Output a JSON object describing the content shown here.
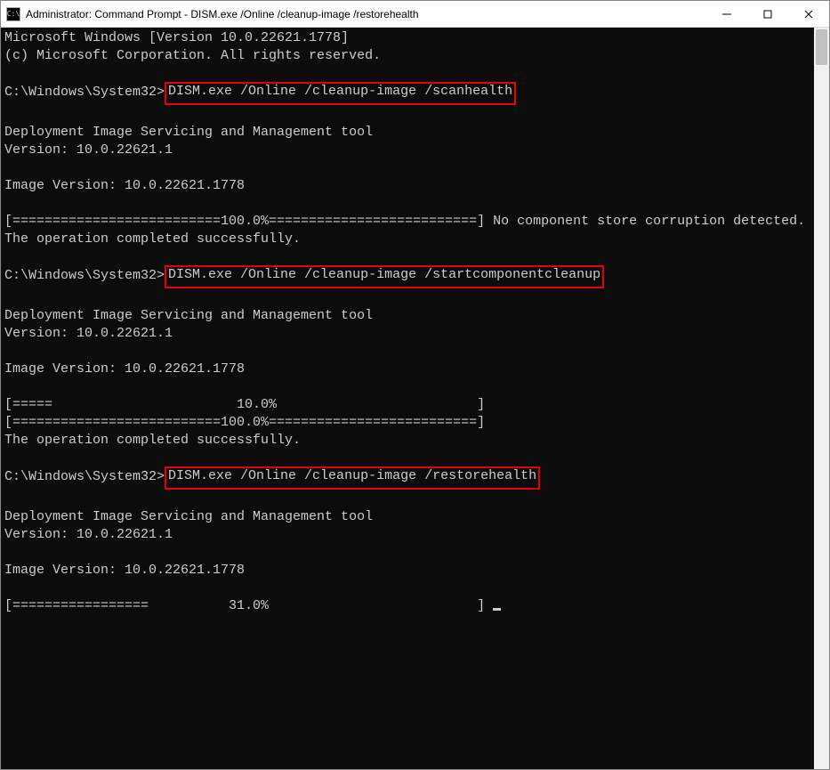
{
  "window": {
    "title": "Administrator: Command Prompt - DISM.exe  /Online /cleanup-image /restorehealth"
  },
  "terminal": {
    "banner1": "Microsoft Windows [Version 10.0.22621.1778]",
    "banner2": "(c) Microsoft Corporation. All rights reserved.",
    "prompt": "C:\\Windows\\System32>",
    "cmd1": "DISM.exe /Online /cleanup-image /scanhealth",
    "tool_line": "Deployment Image Servicing and Management tool",
    "version_line": "Version: 10.0.22621.1",
    "image_version_line": "Image Version: 10.0.22621.1778",
    "progress1": "[==========================100.0%==========================] No component store corruption detected.",
    "completed": "The operation completed successfully.",
    "cmd2": "DISM.exe /Online /cleanup-image /startcomponentcleanup",
    "progress2a": "[=====                       10.0%                         ]",
    "progress2b": "[==========================100.0%==========================]",
    "cmd3": "DISM.exe /Online /cleanup-image /restorehealth",
    "progress3": "[=================          31.0%                          ] "
  }
}
